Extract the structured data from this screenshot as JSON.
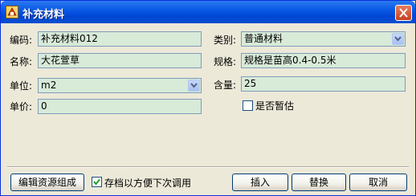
{
  "window": {
    "title": "补充材料",
    "close_symbol": "X"
  },
  "form": {
    "code_label": "编码:",
    "code_value": "补充材料012",
    "name_label": "名称:",
    "name_value": "大花萱草",
    "unit_label": "单位:",
    "unit_value": "m2",
    "price_label": "单价:",
    "price_value": "0",
    "category_label": "类别:",
    "category_value": "普通材料",
    "spec_label": "规格:",
    "spec_value": "规格是苗高0.4-0.5米",
    "content_label": "含量:",
    "content_value": "25",
    "provisional_label": "是否暂估",
    "provisional_checked": false
  },
  "footer": {
    "edit_resources_label": "编辑资源组成",
    "save_default_label": "存档以方便下次调用",
    "save_default_checked": true,
    "insert_label": "插入",
    "replace_label": "替换",
    "cancel_label": "取消"
  },
  "icons": {
    "app": "app-icon",
    "close": "close-icon",
    "dropdown": "chevron-down-icon",
    "check": "checkmark-icon"
  },
  "colors": {
    "titlebar": "#0a5ae6",
    "field_bg": "#d8ead8",
    "dialog_bg": "#ece9d8"
  }
}
